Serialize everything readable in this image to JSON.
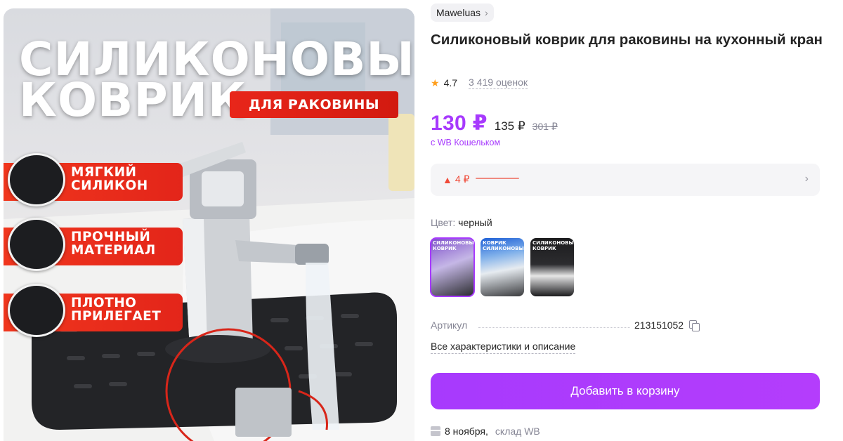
{
  "hero": {
    "title_line1": "СИЛИКОНОВЫЙ",
    "title_line2": "КОВРИК",
    "subtitle": "ДЛЯ РАКОВИНЫ",
    "features": [
      {
        "line1": "МЯГКИЙ",
        "line2": "СИЛИКОН"
      },
      {
        "line1": "ПРОЧНЫЙ",
        "line2": "МАТЕРИАЛ"
      },
      {
        "line1": "ПЛОТНО",
        "line2": "ПРИЛЕГАЕТ"
      }
    ]
  },
  "brand": {
    "name": "Maweluas",
    "icon": "chevron-right-icon"
  },
  "product": {
    "title": "Силиконовый коврик для раковины на кухонный кран"
  },
  "rating": {
    "value": "4.7",
    "count": "3 419 оценок",
    "icon": "star-icon"
  },
  "price": {
    "current": "130 ₽",
    "mid": "135 ₽",
    "old": "301 ₽",
    "wallet_note": "с WB Кошельком"
  },
  "price_change": {
    "text": "4 ₽",
    "direction_icon": "triangle-up-icon"
  },
  "color": {
    "label": "Цвет:",
    "value": "черный",
    "thumbnails": [
      {
        "text": "СИЛИКОНОВЫЙ КОВРИК"
      },
      {
        "text": "КОВРИК СИЛИКОНОВЫЙ"
      },
      {
        "text": "СИЛИКОНОВЫЙ КОВРИК"
      }
    ]
  },
  "article": {
    "label": "Артикул",
    "value": "213151052"
  },
  "all_characteristics": "Все характеристики и описание",
  "cart_button": "Добавить в корзину",
  "delivery": {
    "date": "8 ноября,",
    "warehouse": "склад WB"
  },
  "colors": {
    "accent": "#a73afd",
    "badge_red": "#e3251a",
    "price_drop": "#f04b39"
  }
}
